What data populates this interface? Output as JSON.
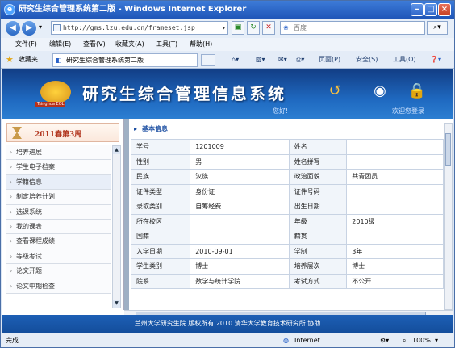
{
  "window": {
    "title": "研究生综合管理系统第二版 - Windows Internet Explorer"
  },
  "address": {
    "url": "http://gms.lzu.edu.cn/frameset.jsp",
    "search_placeholder": "百度"
  },
  "menubar": [
    "文件(F)",
    "编辑(E)",
    "查看(V)",
    "收藏夹(A)",
    "工具(T)",
    "帮助(H)"
  ],
  "favbar": {
    "favorites": "收藏夹",
    "tab_title": "研究生综合管理系统第二版",
    "commands": [
      "页面(P)",
      "安全(S)",
      "工具(O)"
    ]
  },
  "banner": {
    "logo_text": "Tsinghua EOL",
    "system_name": "研究生综合管理信息系统",
    "hello": "您好!",
    "greeting": "欢迎您登录"
  },
  "semester": "2011春第3周",
  "sidebar": {
    "items": [
      "培养进展",
      "学生电子档案",
      "学籍信息",
      "制定培养计划",
      "选课系统",
      "我的课表",
      "查看课程成绩",
      "等级考试",
      "论文开题",
      "论文中期检查"
    ]
  },
  "section_title": "基本信息",
  "info_rows": [
    [
      "学号",
      "1201009",
      "姓名",
      ""
    ],
    [
      "性别",
      "男",
      "姓名拼写",
      ""
    ],
    [
      "民族",
      "汉族",
      "政治面貌",
      "共青团员"
    ],
    [
      "证件类型",
      "身份证",
      "证件号码",
      ""
    ],
    [
      "录取类别",
      "自筹经费",
      "出生日期",
      ""
    ],
    [
      "所在校区",
      "",
      "年级",
      "2010级"
    ],
    [
      "国籍",
      "",
      "籍贯",
      ""
    ],
    [
      "入学日期",
      "2010-09-01",
      "学制",
      "3年"
    ],
    [
      "学生类别",
      "博士",
      "培养层次",
      "博士"
    ],
    [
      "院系",
      "数学与统计学院",
      "考试方式",
      "不公开"
    ]
  ],
  "footer": "兰州大学研究生院 版权所有 2010 清华大学教育技术研究所 协助",
  "status": {
    "left": "完成",
    "zone": "Internet",
    "zoom": "100%"
  }
}
